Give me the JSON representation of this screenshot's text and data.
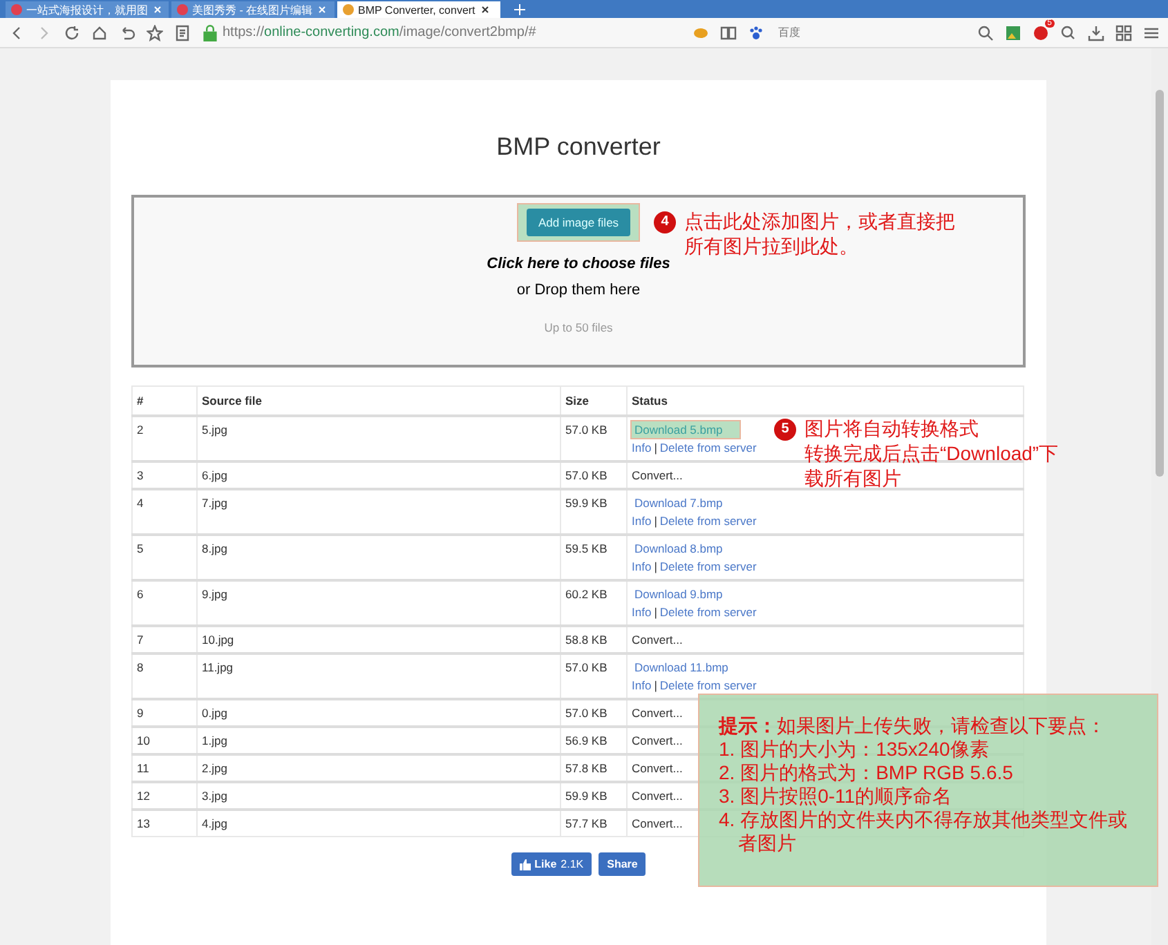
{
  "browser": {
    "tabs": [
      {
        "title": "一站式海报设计，就用图",
        "selected": false
      },
      {
        "title": "美图秀秀 - 在线图片编辑",
        "selected": false
      },
      {
        "title": "BMP Converter, convert",
        "selected": true
      }
    ],
    "address": {
      "scheme": "https://",
      "host": "online-converting.com",
      "path": "/image/convert2bmp/#"
    },
    "search": {
      "placeholder": "百度"
    },
    "badge": "5"
  },
  "page": {
    "title": "BMP converter",
    "dropzone": {
      "add_button": {
        "label": "Add image files",
        "highlighted": true
      },
      "line1": "Click here to choose files",
      "line2": "or Drop them here",
      "limit": "Up to 50 files"
    },
    "table": {
      "columns": [
        "#",
        "Source file",
        "Size",
        "Status"
      ],
      "rows": [
        {
          "n": "2",
          "file": "5.jpg",
          "size": "57.0 KB",
          "kind": "done",
          "download": "Download 5.bmp",
          "info": "Info",
          "sep": "|",
          "delete": "Delete from server",
          "highlighted": true
        },
        {
          "n": "3",
          "file": "6.jpg",
          "size": "57.0 KB",
          "kind": "converting",
          "status": "Convert...",
          "highlighted": false
        },
        {
          "n": "4",
          "file": "7.jpg",
          "size": "59.9 KB",
          "kind": "done",
          "download": "Download 7.bmp",
          "info": "Info",
          "sep": "|",
          "delete": "Delete from server",
          "highlighted": false
        },
        {
          "n": "5",
          "file": "8.jpg",
          "size": "59.5 KB",
          "kind": "done",
          "download": "Download 8.bmp",
          "info": "Info",
          "sep": "|",
          "delete": "Delete from server",
          "highlighted": false
        },
        {
          "n": "6",
          "file": "9.jpg",
          "size": "60.2 KB",
          "kind": "done",
          "download": "Download 9.bmp",
          "info": "Info",
          "sep": "|",
          "delete": "Delete from server",
          "highlighted": false
        },
        {
          "n": "7",
          "file": "10.jpg",
          "size": "58.8 KB",
          "kind": "converting",
          "status": "Convert...",
          "highlighted": false
        },
        {
          "n": "8",
          "file": "11.jpg",
          "size": "57.0 KB",
          "kind": "done",
          "download": "Download 11.bmp",
          "info": "Info",
          "sep": "|",
          "delete": "Delete from server",
          "highlighted": false
        },
        {
          "n": "9",
          "file": "0.jpg",
          "size": "57.0 KB",
          "kind": "converting",
          "status": "Convert...",
          "highlighted": false
        },
        {
          "n": "10",
          "file": "1.jpg",
          "size": "56.9 KB",
          "kind": "converting",
          "status": "Convert...",
          "highlighted": false
        },
        {
          "n": "11",
          "file": "2.jpg",
          "size": "57.8 KB",
          "kind": "converting",
          "status": "Convert...",
          "highlighted": false
        },
        {
          "n": "12",
          "file": "3.jpg",
          "size": "59.9 KB",
          "kind": "converting",
          "status": "Convert...",
          "highlighted": false
        },
        {
          "n": "13",
          "file": "4.jpg",
          "size": "57.7 KB",
          "kind": "converting",
          "status": "Convert...",
          "highlighted": false
        }
      ]
    },
    "like": {
      "label": "Like",
      "count": "2.1K"
    },
    "share": "Share"
  },
  "annotations": [
    {
      "number": "4",
      "lines": [
        "点击此处添加图片，或者直接把",
        "所有图片拉到此处。"
      ]
    },
    {
      "number": "5",
      "lines": [
        "图片将自动转换格式",
        "转换完成后点击“Download”下",
        "载所有图片"
      ]
    }
  ],
  "tip": {
    "heading": "提示：",
    "intro": "如果图片上传失败，请检查以下要点：",
    "items": [
      "1. 图片的大小为：135x240像素",
      "2. 图片的格式为：BMP RGB 5.6.5",
      "3. 图片按照0-11的顺序命名",
      "4. 存放图片的文件夹内不得存放其他类型文件或者图片"
    ]
  }
}
